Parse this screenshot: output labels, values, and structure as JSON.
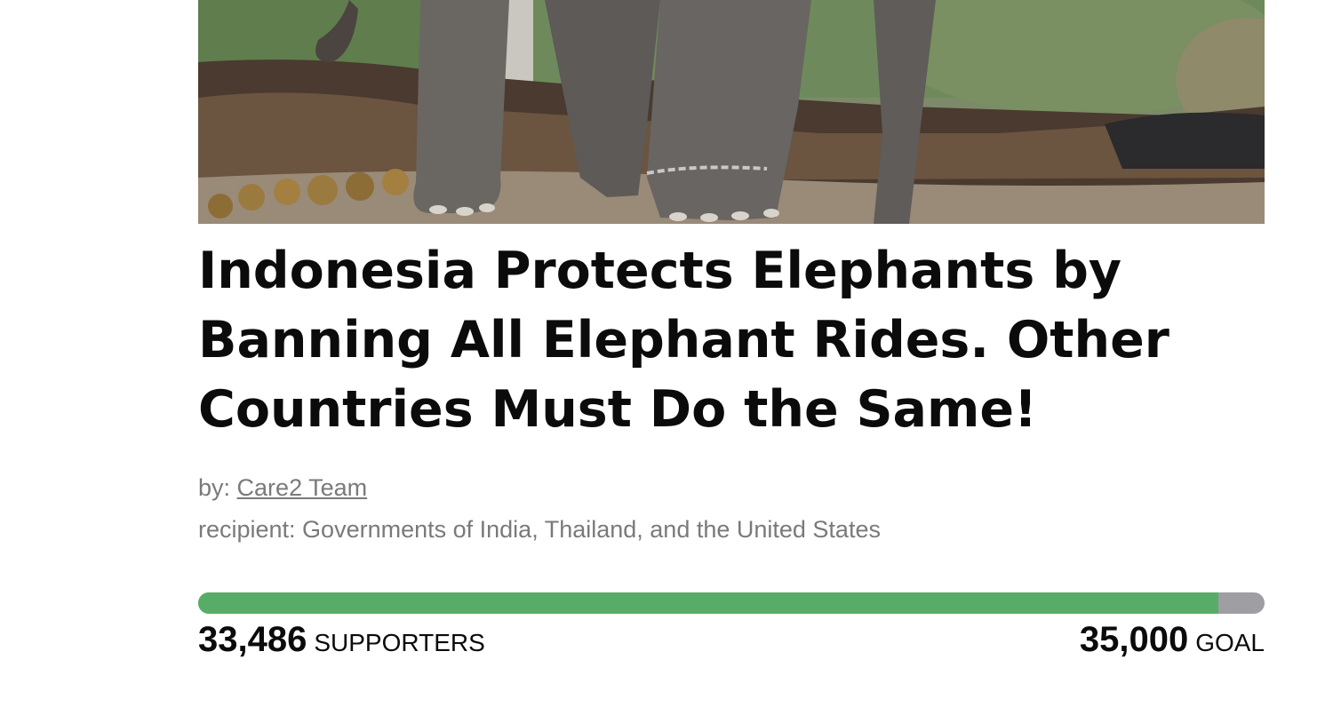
{
  "petition": {
    "title": "Indonesia Protects Elephants by Banning All Elephant Rides. Other Countries Must Do the Same!",
    "by_prefix": "by:",
    "author": "Care2 Team",
    "recipient": "recipient: Governments of India, Thailand, and the United States"
  },
  "progress": {
    "supporters_count": "33,486",
    "supporters_label": "SUPPORTERS",
    "goal_count": "35,000",
    "goal_label": "GOAL",
    "fraction": 0.9567,
    "fill_color": "#57ad68",
    "track_color": "#9e9ea3"
  }
}
